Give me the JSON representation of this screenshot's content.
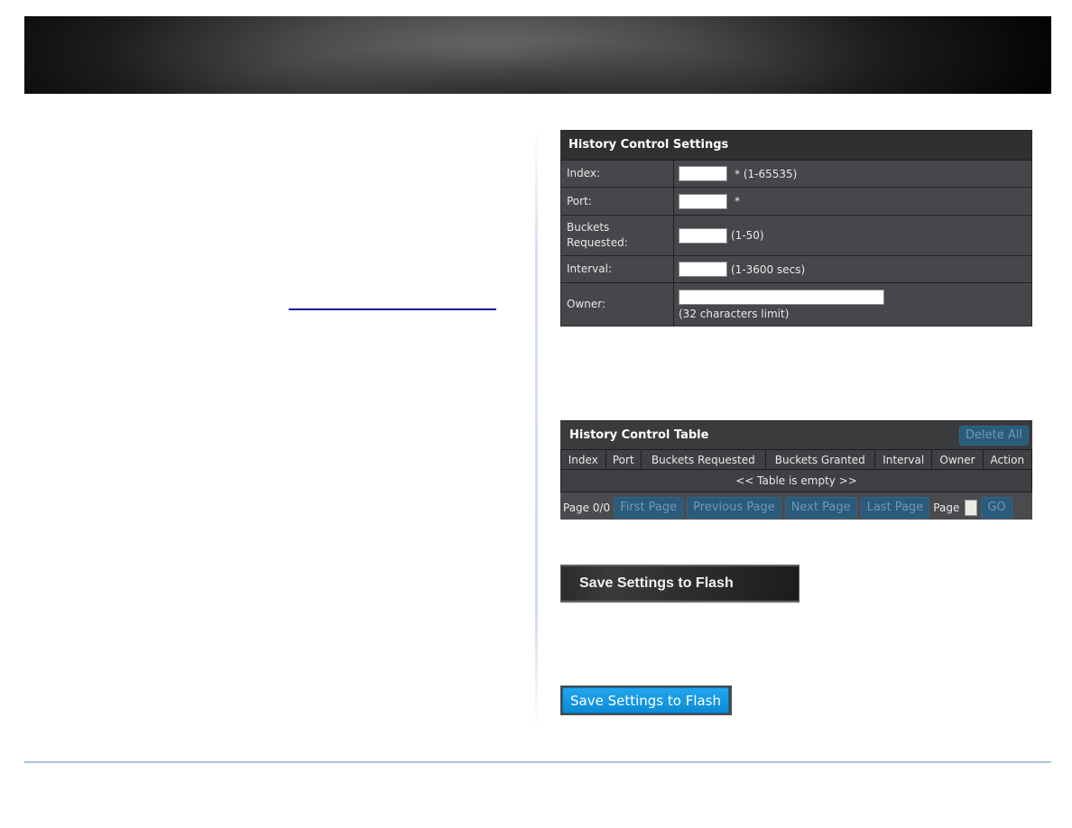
{
  "settings": {
    "title": "History Control Settings",
    "fields": {
      "index": {
        "label": "Index:",
        "value": "",
        "hint": "* (1-65535)"
      },
      "port": {
        "label": "Port:",
        "value": "",
        "hint": "*"
      },
      "buckets": {
        "label": "Buckets Requested:",
        "value": "",
        "hint": "(1-50)"
      },
      "interval": {
        "label": "Interval:",
        "value": "",
        "hint": "(1-3600 secs)"
      },
      "owner": {
        "label": "Owner:",
        "value": "",
        "hint": "(32 characters limit)"
      }
    }
  },
  "table": {
    "title": "History Control Table",
    "delete_all": "Delete All",
    "columns": [
      "Index",
      "Port",
      "Buckets Requested",
      "Buckets Granted",
      "Interval",
      "Owner",
      "Action"
    ],
    "empty_message": "<< Table is empty >>",
    "pager": {
      "status": "Page 0/0",
      "first": "First Page",
      "previous": "Previous Page",
      "next": "Next Page",
      "last": "Last Page",
      "page_label": "Page",
      "page_value": "",
      "go": "GO"
    }
  },
  "buttons": {
    "save_dark": "Save Settings to Flash",
    "save_blue": "Save Settings to Flash"
  }
}
